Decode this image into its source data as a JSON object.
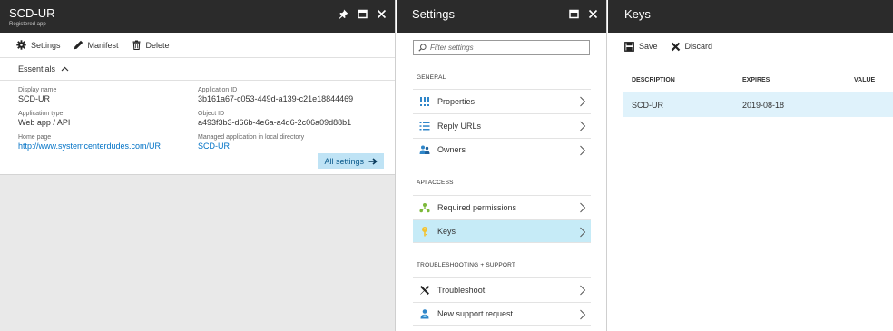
{
  "app_blade": {
    "title": "SCD-UR",
    "subtitle": "Registered app",
    "toolbar": {
      "settings": "Settings",
      "manifest": "Manifest",
      "delete": "Delete"
    },
    "essentials_label": "Essentials",
    "properties": {
      "display_name_label": "Display name",
      "display_name": "SCD-UR",
      "application_type_label": "Application type",
      "application_type": "Web app / API",
      "home_page_label": "Home page",
      "home_page": "http://www.systemcenterdudes.com/UR",
      "application_id_label": "Application ID",
      "application_id": "3b161a67-c053-449d-a139-c21e18844469",
      "object_id_label": "Object ID",
      "object_id": "a493f3b3-d66b-4e6a-a4d6-2c06a09d88b1",
      "managed_app_label": "Managed application in local directory",
      "managed_app": "SCD-UR"
    },
    "all_settings": "All settings"
  },
  "settings_blade": {
    "title": "Settings",
    "filter_placeholder": "Filter settings",
    "sections": {
      "general": "GENERAL",
      "api_access": "API ACCESS",
      "troubleshooting": "TROUBLESHOOTING + SUPPORT"
    },
    "items": {
      "properties": "Properties",
      "reply_urls": "Reply URLs",
      "owners": "Owners",
      "required_permissions": "Required permissions",
      "keys": "Keys",
      "troubleshoot": "Troubleshoot",
      "new_support_request": "New support request"
    }
  },
  "keys_blade": {
    "title": "Keys",
    "toolbar": {
      "save": "Save",
      "discard": "Discard"
    },
    "columns": {
      "description": "DESCRIPTION",
      "expires": "EXPIRES",
      "value": "VALUE"
    },
    "rows": [
      {
        "description": "SCD-UR",
        "expires": "2019-08-18",
        "value": ""
      }
    ]
  },
  "colors": {
    "header_bg": "#2b2b2b",
    "link": "#0072c6",
    "selected_bg": "#c6ebf7",
    "accent_button_bg": "#bfe3f5"
  }
}
